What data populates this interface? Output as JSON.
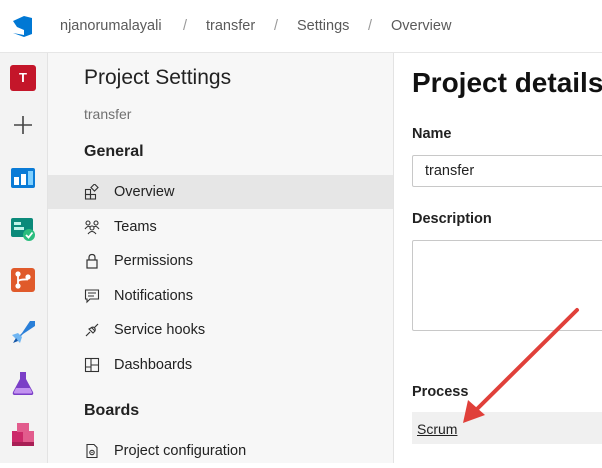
{
  "header": {
    "breadcrumb": [
      "njanorumalayali",
      "transfer",
      "Settings",
      "Overview"
    ],
    "separator": "/"
  },
  "leftrail": {
    "project_initial": "T",
    "items": [
      "project-avatar",
      "add-icon",
      "boards-icon",
      "test-plans-icon",
      "repos-icon",
      "pipelines-icon",
      "artifacts-test-icon",
      "artifacts-icon"
    ]
  },
  "settings_nav": {
    "title": "Project Settings",
    "project": "transfer",
    "sections": [
      {
        "heading": "General",
        "items": [
          {
            "label": "Overview",
            "icon": "overview-icon",
            "selected": true
          },
          {
            "label": "Teams",
            "icon": "teams-icon"
          },
          {
            "label": "Permissions",
            "icon": "lock-icon"
          },
          {
            "label": "Notifications",
            "icon": "notifications-icon"
          },
          {
            "label": "Service hooks",
            "icon": "service-hooks-icon"
          },
          {
            "label": "Dashboards",
            "icon": "dashboards-icon"
          }
        ]
      },
      {
        "heading": "Boards",
        "items": [
          {
            "label": "Project configuration",
            "icon": "project-configuration-icon"
          }
        ]
      }
    ]
  },
  "main": {
    "title": "Project details",
    "name_label": "Name",
    "name_value": "transfer",
    "description_label": "Description",
    "description_value": "",
    "process_label": "Process",
    "process_value": "Scrum"
  },
  "colors": {
    "accent": "#0078d4",
    "annotation_arrow": "#e0403a",
    "project_avatar": "#c4162a"
  }
}
